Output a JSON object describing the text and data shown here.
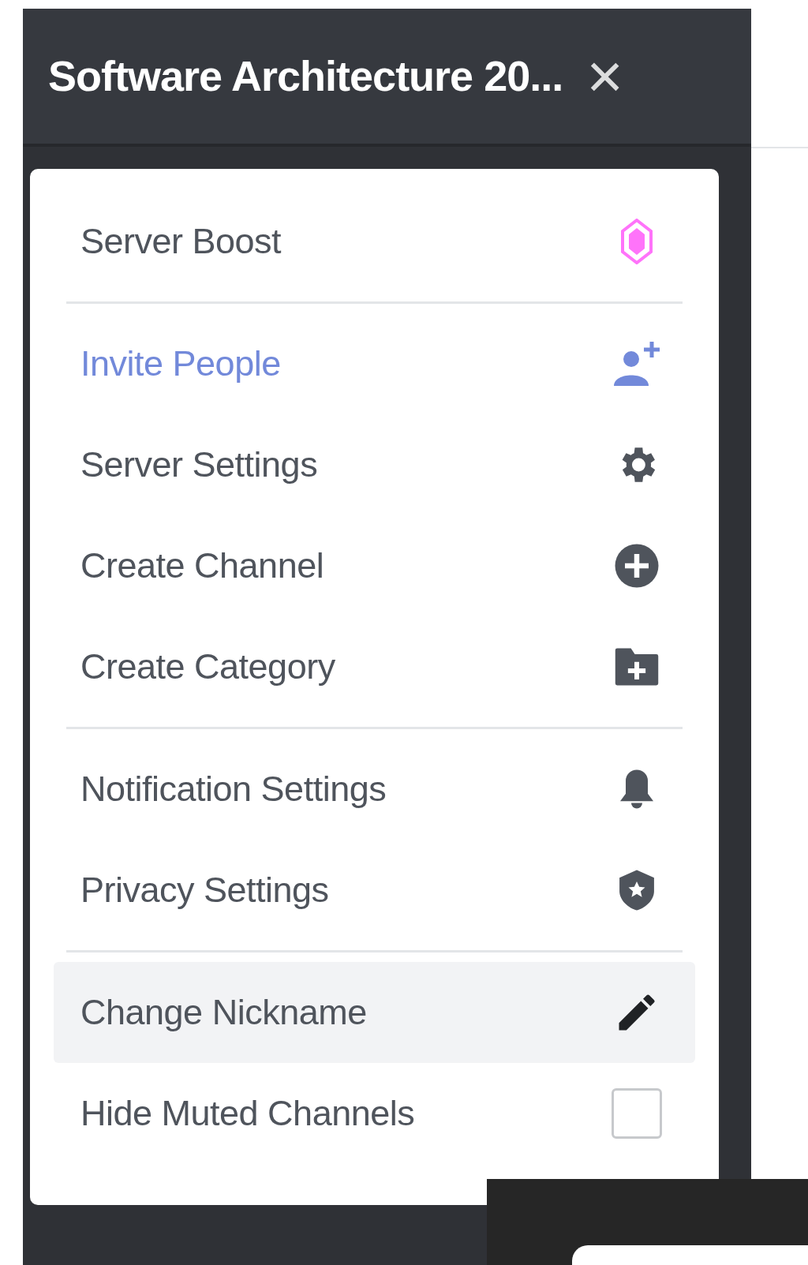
{
  "header": {
    "title": "Software Architecture 20...",
    "close": "×"
  },
  "menu": {
    "sections": [
      {
        "items": [
          {
            "label": "Server Boost",
            "kind": "boost",
            "selected": false
          }
        ]
      },
      {
        "items": [
          {
            "label": "Invite People",
            "kind": "invite",
            "selected": false
          },
          {
            "label": "Server Settings",
            "kind": "settings",
            "selected": false
          },
          {
            "label": "Create Channel",
            "kind": "create-channel",
            "selected": false
          },
          {
            "label": "Create Category",
            "kind": "create-category",
            "selected": false
          }
        ]
      },
      {
        "items": [
          {
            "label": "Notification Settings",
            "kind": "notifications",
            "selected": false
          },
          {
            "label": "Privacy Settings",
            "kind": "privacy",
            "selected": false
          }
        ]
      },
      {
        "items": [
          {
            "label": "Change Nickname",
            "kind": "nickname",
            "selected": true
          },
          {
            "label": "Hide Muted Channels",
            "kind": "checkbox",
            "checked": false,
            "selected": false
          }
        ]
      }
    ]
  }
}
